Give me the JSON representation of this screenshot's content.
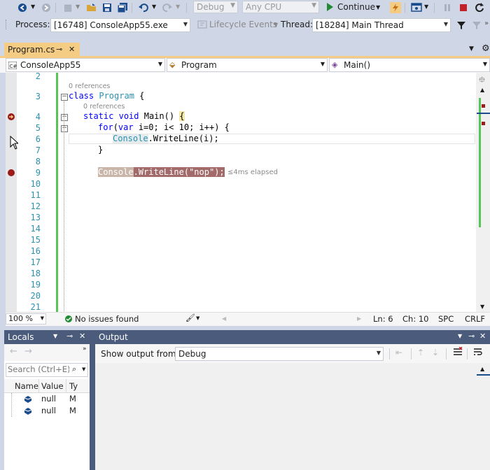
{
  "toolbar": {
    "config": "Debug",
    "platform": "Any CPU",
    "continue_label": "Continue"
  },
  "debug_location": {
    "process_label": "Process:",
    "process_value": "[16748] ConsoleApp55.exe",
    "lifecycle_label": "Lifecycle Events",
    "thread_label": "Thread:",
    "thread_value": "[18284] Main Thread"
  },
  "editor_tab": {
    "label": "Program.cs",
    "pin_glyph": "⊸",
    "close_glyph": "✕"
  },
  "nav_bar": {
    "project": "ConsoleApp55",
    "class": "Program",
    "member": "Main()"
  },
  "code": {
    "line_numbers": [
      "2",
      "3",
      "4",
      "5",
      "6",
      "7",
      "8",
      "9",
      "10",
      "11",
      "12",
      "13",
      "14",
      "15",
      "16",
      "17",
      "18",
      "19",
      "20",
      "21"
    ],
    "lens_class": "0 references",
    "lens_main": "0 references",
    "line3": {
      "kw": "class",
      "type": "Program",
      "rest": " {"
    },
    "line4": {
      "kw1": "static",
      "kw2": "void",
      "name": " Main() ",
      "brace": "{"
    },
    "line5": {
      "kw": "for",
      "p1": "(",
      "kw2": "var",
      "rest": " i=0; i< 10; i++) {"
    },
    "line6": {
      "type": "Console",
      "rest": ".WriteLine(i);"
    },
    "line7": "}",
    "line9": {
      "type": "Console",
      "mid": ".WriteLine(",
      "str": "\"nop\"",
      "end": ");"
    },
    "elapsed": "≤4ms elapsed"
  },
  "status_strip": {
    "zoom": "100 %",
    "issues": "No issues found",
    "ln": "Ln: 6",
    "ch": "Ch: 10",
    "spc": "SPC",
    "crlf": "CRLF"
  },
  "locals": {
    "title": "Locals",
    "search_placeholder": "Search (Ctrl+E)",
    "columns": [
      "Name",
      "Value",
      "Ty"
    ],
    "rows": [
      {
        "value": "null",
        "type": "M"
      },
      {
        "value": "null",
        "type": "M"
      }
    ]
  },
  "output": {
    "title": "Output",
    "show_label": "Show output from:",
    "source": "Debug"
  },
  "colors": {
    "accent_blue": "#1a4c8e",
    "tab_active": "#f5cc84",
    "panel_header": "#4a5b7c",
    "change_green": "#57c457",
    "breakpoint": "#9b1b1b",
    "current_stmt": "#a36a6a"
  }
}
